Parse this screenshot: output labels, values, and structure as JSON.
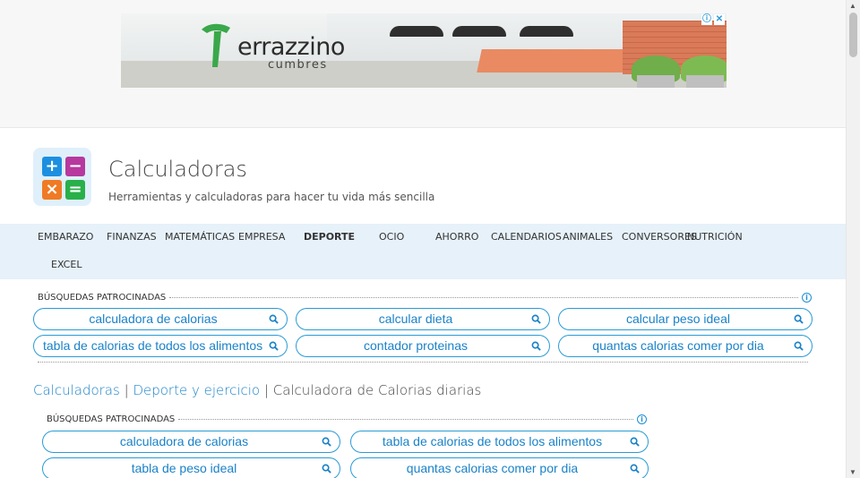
{
  "ad": {
    "brand": "errazzino",
    "sub": "cumbres"
  },
  "site": {
    "title": "Calculadoras",
    "tagline": "Herramientas y calculadoras para hacer tu vida más sencilla",
    "logo_tiles": [
      "+",
      "−",
      "×",
      "="
    ],
    "logo_colors": [
      "#1d8fe0",
      "#b7389e",
      "#f07a24",
      "#29b04a"
    ]
  },
  "nav": {
    "items": [
      "EMBARAZO",
      "FINANZAS",
      "MATEMÁTICAS",
      "EMPRESA",
      "DEPORTE",
      "OCIO",
      "AHORRO",
      "CALENDARIOS",
      "ANIMALES",
      "CONVERSORES",
      "NUTRICIÓN",
      "EXCEL"
    ],
    "active": "DEPORTE"
  },
  "sponsored1": {
    "heading": "BÚSQUEDAS PATROCINADAS",
    "pills": [
      "calculadora de calorias",
      "calcular dieta",
      "calcular peso ideal",
      "tabla de calorias de todos los alimentos",
      "contador proteinas",
      "quantas calorias comer por dia"
    ]
  },
  "breadcrumb": {
    "link1": "Calculadoras",
    "link2": "Deporte y ejercicio",
    "current": "Calculadora de Calorias diarias",
    "sep": "|"
  },
  "sponsored2": {
    "heading": "BÚSQUEDAS PATROCINADAS",
    "pills": [
      "calculadora de calorias",
      "tabla de calorias de todos los alimentos",
      "tabla de peso ideal",
      "quantas calorias comer por dia"
    ]
  },
  "colors": {
    "accent": "#1a82c8",
    "nav_bg": "#e6f1f9"
  }
}
